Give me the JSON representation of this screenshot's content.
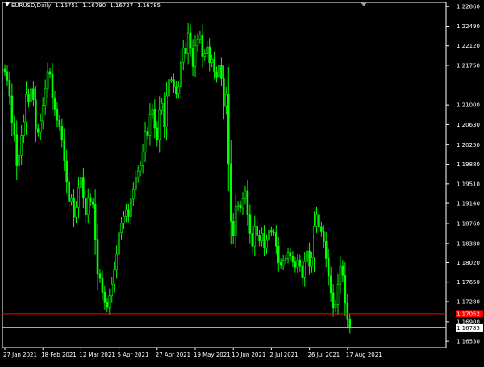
{
  "title": {
    "symbol_timeframe": "EURUSD,Daily",
    "open": "1.16751",
    "high": "1.16790",
    "low": "1.16727",
    "close": "1.16785"
  },
  "colors": {
    "background": "#000000",
    "frame": "#ffffff",
    "candle": "#00ff00",
    "axis_text": "#ffffff",
    "level_line": "#ff0000",
    "level_label_bg": "#ff0000",
    "bid_line": "#c0c0c0",
    "bid_label_bg": "#ffffff",
    "bid_label_text": "#000000"
  },
  "chart_data": {
    "type": "candlestick",
    "symbol": "EURUSD",
    "timeframe": "Daily",
    "ylim": [
      1.1641,
      1.2294
    ],
    "y_ticks": [
      "1.22860",
      "1.22490",
      "1.22120",
      "1.21750",
      "1.21000",
      "1.20630",
      "1.20250",
      "1.19880",
      "1.19510",
      "1.19140",
      "1.18760",
      "1.18380",
      "1.18020",
      "1.17650",
      "1.17280",
      "1.16900",
      "1.16530"
    ],
    "x_ticks": [
      "27 Jan 2021",
      "18 Feb 2021",
      "12 Mar 2021",
      "5 Apr 2021",
      "27 Apr 2021",
      "19 May 2021",
      "10 Jun 2021",
      "2 Jul 2021",
      "26 Jul 2021",
      "17 Aug 2021"
    ],
    "x_tick_bar_index": [
      0,
      16,
      32,
      48,
      64,
      80,
      96,
      112,
      128,
      144
    ],
    "horizontal_level": {
      "label": "1.17052",
      "value": 1.17052
    },
    "bid_line": {
      "label": "1.16785",
      "value": 1.16785
    },
    "closes": [
      1.2163,
      1.2147,
      1.2117,
      1.2066,
      1.2044,
      1.1985,
      1.2005,
      1.2043,
      1.2068,
      1.212,
      1.2106,
      1.2131,
      1.211,
      1.2055,
      1.2048,
      1.207,
      1.2099,
      1.2131,
      1.2163,
      1.2158,
      1.2113,
      1.2092,
      1.2071,
      1.206,
      1.2035,
      1.1995,
      1.1954,
      1.1918,
      1.1923,
      1.1888,
      1.1906,
      1.1944,
      1.1962,
      1.1924,
      1.1893,
      1.1925,
      1.1917,
      1.1912,
      1.1846,
      1.178,
      1.1772,
      1.1746,
      1.1726,
      1.1717,
      1.1739,
      1.1761,
      1.1788,
      1.1818,
      1.1858,
      1.1876,
      1.1889,
      1.1902,
      1.1889,
      1.1922,
      1.1941,
      1.1963,
      1.1975,
      1.1985,
      1.2011,
      1.2049,
      1.2043,
      1.2083,
      1.2092,
      1.2056,
      1.2035,
      1.2091,
      1.2103,
      1.2059,
      1.2117,
      1.2148,
      1.2148,
      1.2134,
      1.2122,
      1.2134,
      1.2181,
      1.2208,
      1.2197,
      1.2236,
      1.2207,
      1.2173,
      1.2212,
      1.2225,
      1.2232,
      1.2191,
      1.2197,
      1.221,
      1.218,
      1.2187,
      1.2163,
      1.2152,
      1.2175,
      1.215,
      1.2097,
      1.212,
      1.1989,
      1.188,
      1.1853,
      1.1907,
      1.1911,
      1.1905,
      1.1923,
      1.1937,
      1.1893,
      1.1857,
      1.1833,
      1.1871,
      1.1854,
      1.1843,
      1.1857,
      1.1829,
      1.1844,
      1.1863,
      1.1859,
      1.1858,
      1.1833,
      1.1802,
      1.1797,
      1.1807,
      1.181,
      1.182,
      1.1814,
      1.1803,
      1.1793,
      1.1807,
      1.1795,
      1.1773,
      1.1804,
      1.1824,
      1.1795,
      1.1811,
      1.1871,
      1.1893,
      1.187,
      1.186,
      1.1842,
      1.181,
      1.1777,
      1.1745,
      1.1716,
      1.1723,
      1.1761,
      1.1795,
      1.1778,
      1.1725,
      1.1694,
      1.1679
    ]
  }
}
